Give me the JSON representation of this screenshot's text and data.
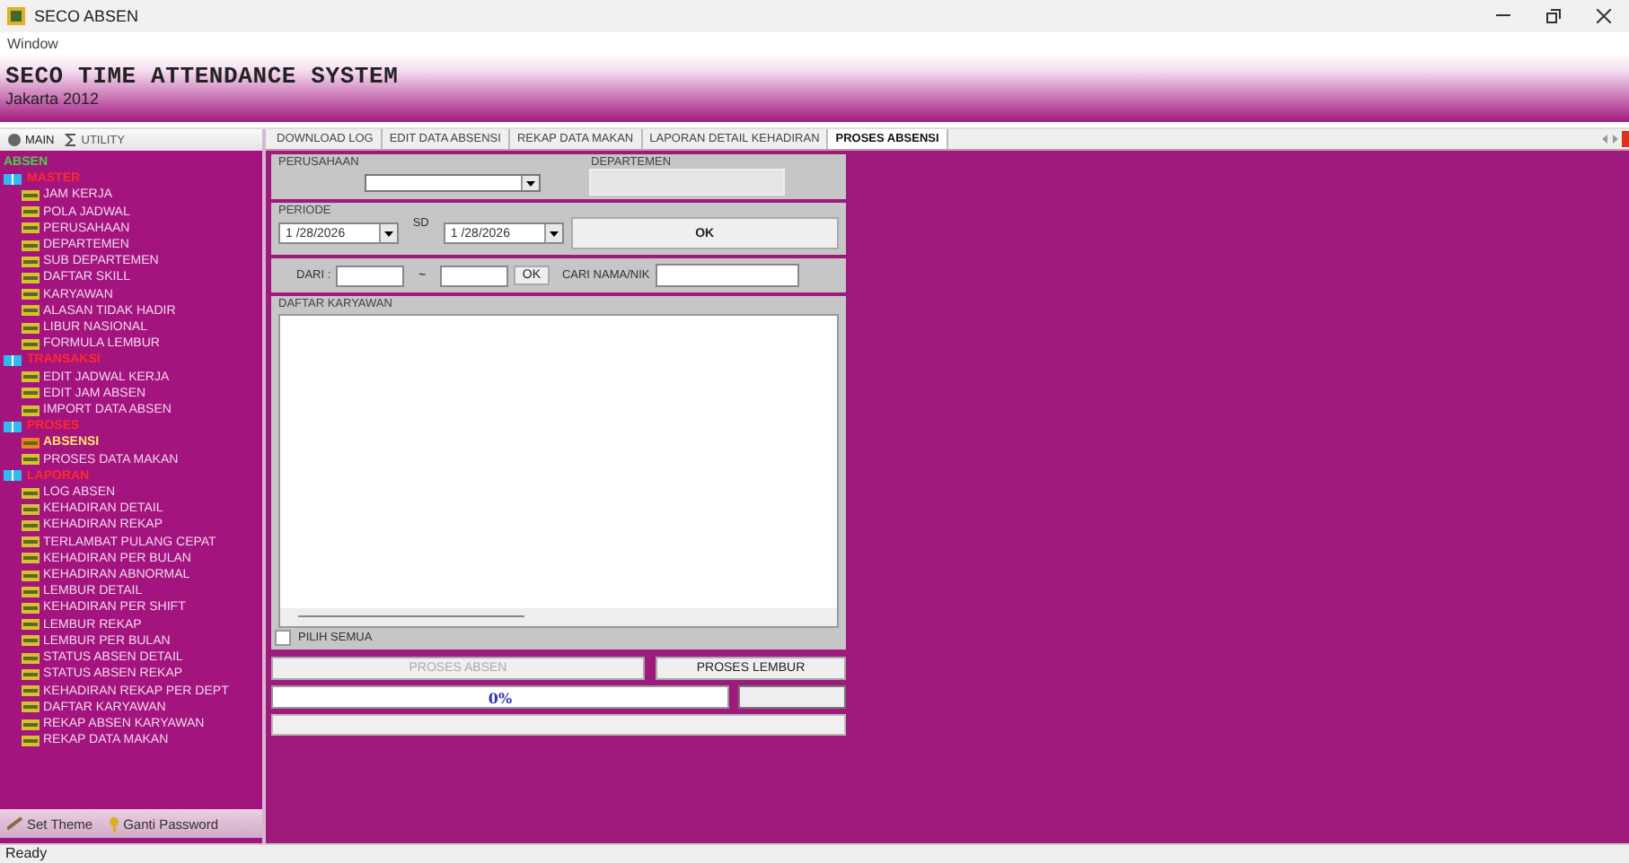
{
  "window": {
    "title": "SECO ABSEN"
  },
  "menu": [
    "Window"
  ],
  "banner": {
    "title": "SECO TIME ATTENDANCE SYSTEM",
    "subtitle": "Jakarta 2012"
  },
  "sidebar": {
    "tabs": [
      {
        "label": "MAIN",
        "selected": true
      },
      {
        "label": "UTILITY",
        "selected": false
      }
    ],
    "tree": {
      "label": "ABSEN",
      "children": [
        {
          "label": "MASTER",
          "children": [
            {
              "label": "JAM KERJA",
              "selected": false
            },
            {
              "label": "POLA JADWAL",
              "selected": false
            },
            {
              "label": "PERUSAHAAN",
              "selected": false
            },
            {
              "label": "DEPARTEMEN",
              "selected": false
            },
            {
              "label": "SUB DEPARTEMEN",
              "selected": false
            },
            {
              "label": "DAFTAR SKILL",
              "selected": false
            },
            {
              "label": "KARYAWAN",
              "selected": false
            },
            {
              "label": "ALASAN TIDAK HADIR",
              "selected": false
            },
            {
              "label": "LIBUR NASIONAL",
              "selected": false
            },
            {
              "label": "FORMULA LEMBUR",
              "selected": false
            }
          ]
        },
        {
          "label": "TRANSAKSI",
          "children": [
            {
              "label": "EDIT JADWAL KERJA",
              "selected": false
            },
            {
              "label": "EDIT JAM ABSEN",
              "selected": false
            },
            {
              "label": "IMPORT DATA ABSEN",
              "selected": false
            }
          ]
        },
        {
          "label": "PROSES",
          "children": [
            {
              "label": "ABSENSI",
              "selected": true
            },
            {
              "label": "PROSES DATA MAKAN",
              "selected": false
            }
          ]
        },
        {
          "label": "LAPORAN",
          "children": [
            {
              "label": "LOG ABSEN",
              "selected": false
            },
            {
              "label": "KEHADIRAN DETAIL",
              "selected": false
            },
            {
              "label": "KEHADIRAN REKAP",
              "selected": false
            },
            {
              "label": "TERLAMBAT PULANG CEPAT",
              "selected": false
            },
            {
              "label": "KEHADIRAN PER BULAN",
              "selected": false
            },
            {
              "label": "KEHADIRAN ABNORMAL",
              "selected": false
            },
            {
              "label": "LEMBUR DETAIL",
              "selected": false
            },
            {
              "label": "KEHADIRAN PER SHIFT",
              "selected": false
            },
            {
              "label": "LEMBUR REKAP",
              "selected": false
            },
            {
              "label": "LEMBUR PER BULAN",
              "selected": false
            },
            {
              "label": "STATUS ABSEN DETAIL",
              "selected": false
            },
            {
              "label": "STATUS ABSEN REKAP",
              "selected": false
            },
            {
              "label": "KEHADIRAN REKAP PER DEPT",
              "selected": false
            },
            {
              "label": "DAFTAR KARYAWAN",
              "selected": false
            },
            {
              "label": "REKAP ABSEN KARYAWAN",
              "selected": false
            },
            {
              "label": "REKAP DATA MAKAN",
              "selected": false
            }
          ]
        }
      ]
    },
    "footer_buttons": [
      "Set Theme",
      "Ganti Password"
    ]
  },
  "tabs": [
    {
      "label": "DOWNLOAD LOG",
      "selected": false
    },
    {
      "label": "EDIT DATA ABSENSI",
      "selected": false
    },
    {
      "label": "REKAP DATA MAKAN",
      "selected": false
    },
    {
      "label": "LAPORAN DETAIL KEHADIRAN",
      "selected": false
    },
    {
      "label": "PROSES ABSENSI",
      "selected": true
    }
  ],
  "form": {
    "perusahaan_label": "PERUSAHAAN",
    "departemen_label": "DEPARTEMEN",
    "periode_label": "PERIODE",
    "date_from": "1 /28/2026",
    "sd_label": "SD",
    "date_to": "1 /28/2026",
    "ok_button": "OK",
    "dari_label": "DARI :",
    "range_sep": "~",
    "dari_ok": "OK",
    "search_label": "CARI NAMA/NIK",
    "list_label": "DAFTAR KARYAWAN",
    "select_all": {
      "label": "PILIH SEMUA",
      "checked": false
    },
    "proses_absen": {
      "label": "PROSES ABSEN",
      "disabled": true
    },
    "proses_lembur": {
      "label": "PROSES LEMBUR",
      "disabled": false
    },
    "progress": {
      "level": 0,
      "reading": "0%"
    }
  },
  "status_bar": "Ready"
}
